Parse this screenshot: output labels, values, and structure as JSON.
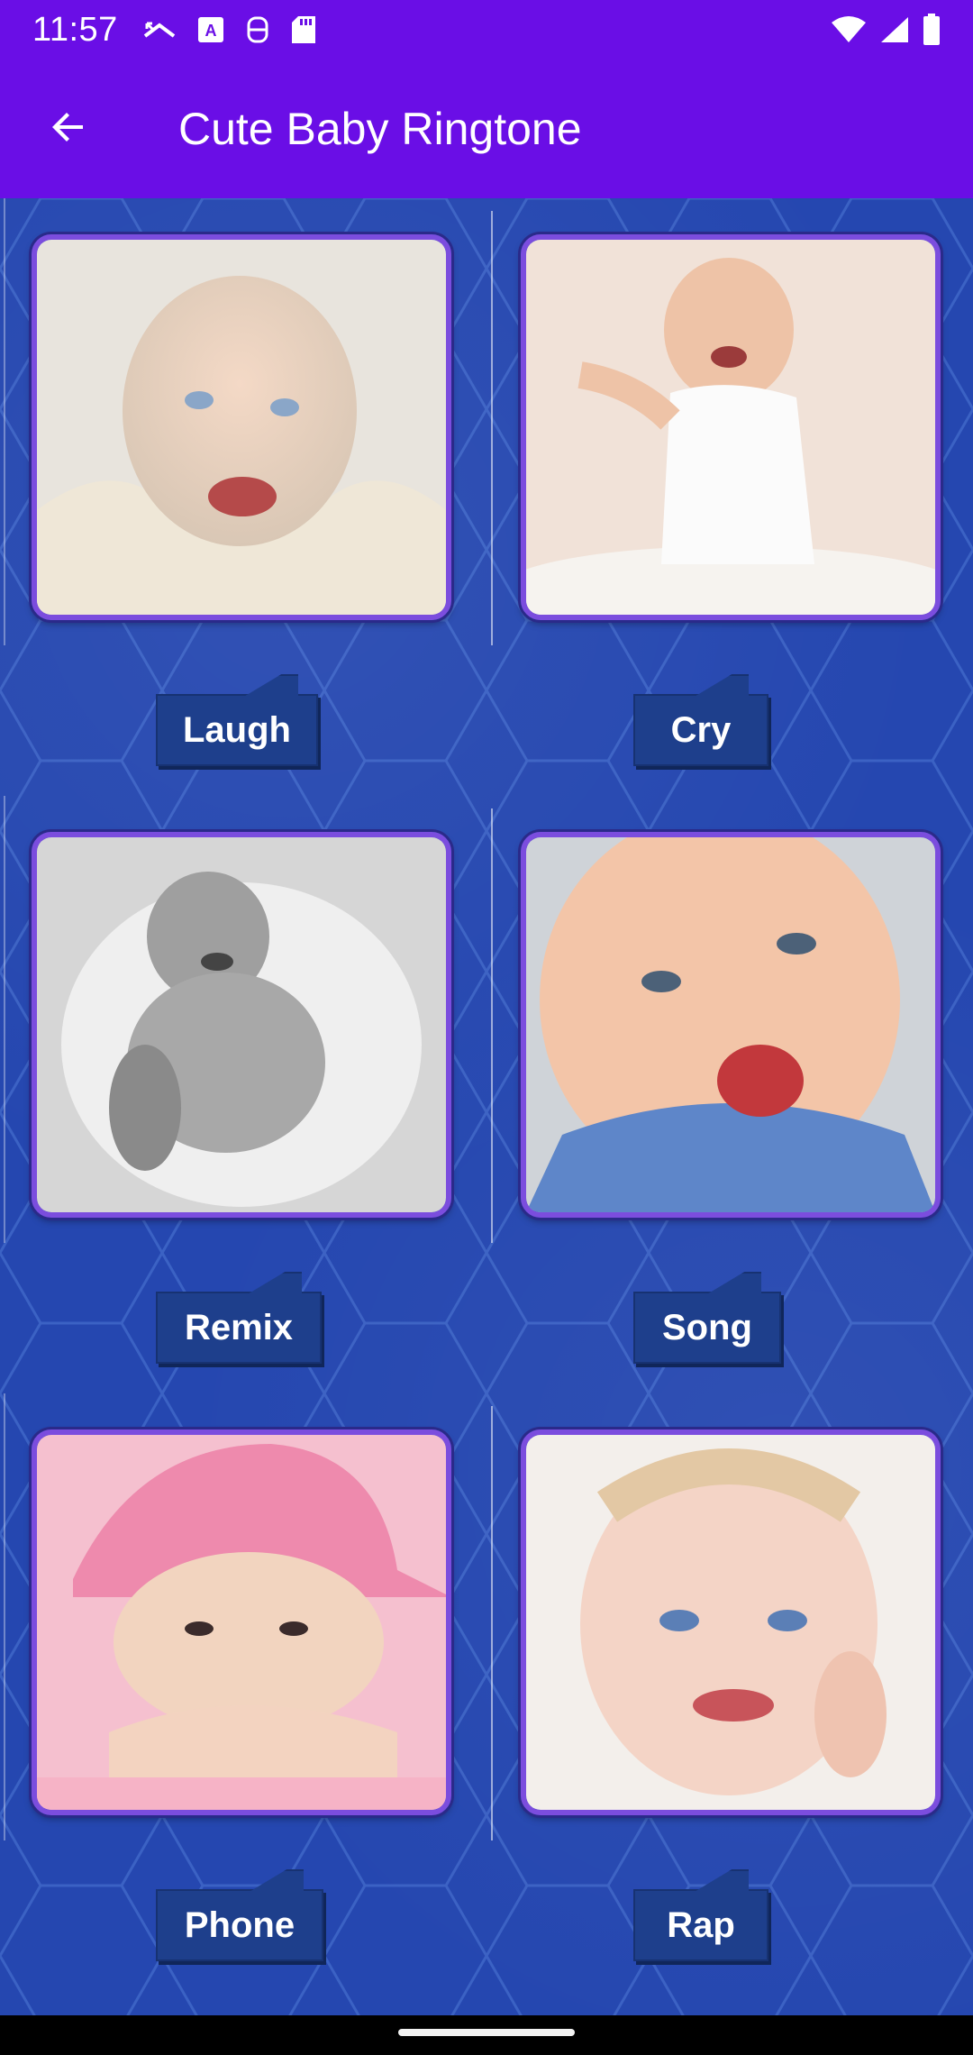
{
  "status_bar": {
    "time": "11:57",
    "icons_left": [
      "missed-call-icon",
      "text-a-icon",
      "accessibility-icon",
      "sd-card-icon"
    ],
    "icons_right": [
      "wifi-icon",
      "cell-signal-icon",
      "battery-icon"
    ]
  },
  "app_bar": {
    "back_icon": "arrow-back-icon",
    "title": "Cute Baby Ringtone"
  },
  "categories": [
    {
      "label": "Laugh",
      "image": "baby-laugh-image"
    },
    {
      "label": "Cry",
      "image": "baby-cry-image"
    },
    {
      "label": "Remix",
      "image": "baby-remix-image"
    },
    {
      "label": "Song",
      "image": "baby-song-image"
    },
    {
      "label": "Phone",
      "image": "baby-phone-image"
    },
    {
      "label": "Rap",
      "image": "baby-rap-image"
    }
  ],
  "colors": {
    "app_bar": "#6a0ee6",
    "background": "#2547b0",
    "button": "#1e3f8c",
    "photo_border": "#7b4dde"
  }
}
